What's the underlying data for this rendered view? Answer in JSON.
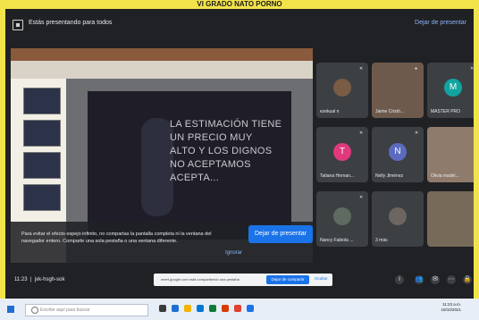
{
  "header": {
    "presentation_title": "Estás presentando para todos",
    "stop_link": "Dejar de presentar"
  },
  "slide": {
    "text_lines": [
      "LA ESTIMACIÓN TIENE",
      "UN PRECIO MUY",
      "ALTO Y LOS DIGNOS",
      "NO ACEPTAMOS",
      "ACEPTA..."
    ]
  },
  "warning": {
    "text": "Para evitar el efecto espejo infinito, no compartas la pantalla completa ni la ventana del navegador entero. Comparte una sola pestaña o una ventana diferente.",
    "stop_button": "Dejar de presentar",
    "ignore": "Ignorar"
  },
  "participants": [
    {
      "name": "ezekual n",
      "initial": "",
      "color": "#7a5b44",
      "has_video": false
    },
    {
      "name": "Jaime Cristó...",
      "initial": "",
      "color": "#6e5a4c",
      "has_video": true
    },
    {
      "name": "MASTER PRO",
      "initial": "M",
      "color": "#12a4a0",
      "has_video": false
    },
    {
      "name": "Tatiana Hernan...",
      "initial": "T",
      "color": "#e0397e",
      "has_video": false
    },
    {
      "name": "Nelly Jiménez",
      "initial": "N",
      "color": "#5c6bc0",
      "has_video": false
    },
    {
      "name": "Olivia madel...",
      "initial": "",
      "color": "#8f7b6b",
      "has_video": true
    },
    {
      "name": "Nancy Fabiola ...",
      "initial": "",
      "color": "#5e6b60",
      "has_video": false
    },
    {
      "name": "3 más",
      "initial": "",
      "color": "#6d6560",
      "has_video": false
    },
    {
      "name": "",
      "initial": "",
      "color": "#776a58",
      "has_video": true
    }
  ],
  "meeting": {
    "time": "11:23",
    "code": "jxk-hsgh-sok"
  },
  "sharebar": {
    "text": "meet.google.com está compartiendo una pestaña",
    "stop": "Dejar de compartir",
    "hide": "Ocultar"
  },
  "taskbar": {
    "search_placeholder": "Escribe aquí para buscar",
    "clock_time": "11:23 a.m.",
    "clock_date": "19/10/2021"
  },
  "topline": "VI GRADO NATO PORNO"
}
